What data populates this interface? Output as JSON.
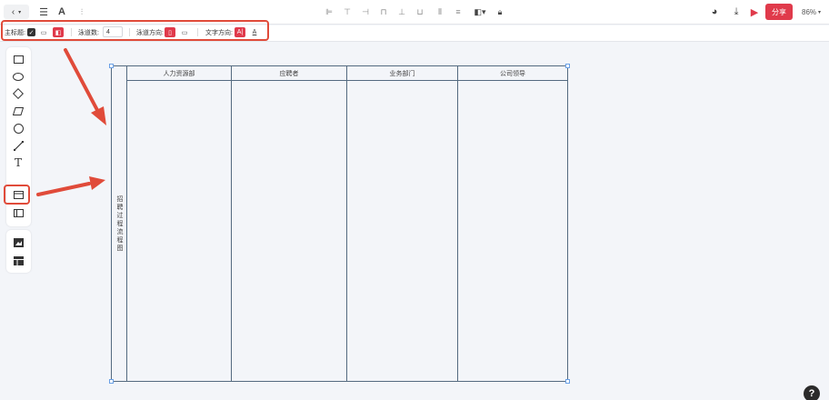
{
  "topbar": {
    "zoom": "86%",
    "share_label": "分享"
  },
  "properties": {
    "title_label": "主标题:",
    "lane_count_label": "泳道数:",
    "lane_count_value": "4",
    "lane_direction_label": "泳道方向:",
    "text_direction_label": "文字方向:",
    "text_dir_horizontal": "A|",
    "text_dir_vertical": "A"
  },
  "swimlane": {
    "title": "招聘过程流程图",
    "lanes": [
      {
        "label": "人力资源部"
      },
      {
        "label": "应聘者"
      },
      {
        "label": "业务部门"
      },
      {
        "label": "公司领导"
      }
    ]
  },
  "help": {
    "label": "?"
  },
  "colors": {
    "accent": "#e03a4b",
    "annotation": "#e04b3a",
    "lane_border": "#546a80"
  }
}
